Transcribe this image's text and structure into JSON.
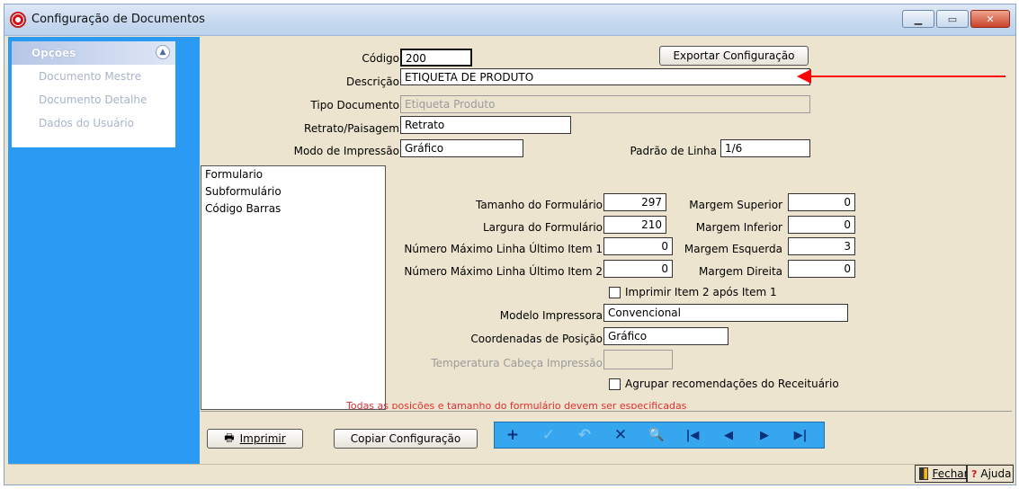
{
  "window": {
    "title": "Configuração de Documentos"
  },
  "sidebar": {
    "header": "Opções",
    "items": [
      {
        "label": "Documento Mestre"
      },
      {
        "label": "Documento Detalhe"
      },
      {
        "label": "Dados do Usuário"
      }
    ]
  },
  "form": {
    "codigo": {
      "label": "Código",
      "value": "200"
    },
    "exportar_label": "Exportar Configuração",
    "descricao": {
      "label": "Descrição",
      "value": "ETIQUETA DE PRODUTO"
    },
    "tipo_documento": {
      "label": "Tipo Documento",
      "value": "Etiqueta Produto"
    },
    "retrato": {
      "label": "Retrato/Paisagem",
      "value": "Retrato"
    },
    "modo_impressao": {
      "label": "Modo de Impressão",
      "value": "Gráfico"
    },
    "padrao_linha": {
      "label": "Padrão de Linha",
      "value": "1/6"
    }
  },
  "list": {
    "items": [
      "Formulario",
      "Subformulário",
      "Código Barras"
    ]
  },
  "details": {
    "tamanho": {
      "label": "Tamanho do Formulário",
      "value": "297"
    },
    "largura": {
      "label": "Largura do Formulário",
      "value": "210"
    },
    "num_max1": {
      "label": "Número Máximo Linha Último Item 1",
      "value": "0"
    },
    "num_max2": {
      "label": "Número Máximo Linha Último Item 2",
      "value": "0"
    },
    "margem_superior": {
      "label": "Margem Superior",
      "value": "0"
    },
    "margem_inferior": {
      "label": "Margem Inferior",
      "value": "0"
    },
    "margem_esquerda": {
      "label": "Margem Esquerda",
      "value": "3"
    },
    "margem_direita": {
      "label": "Margem Direita",
      "value": "0"
    },
    "imprimir_item2": {
      "label": "Imprimir Item 2 após Item 1",
      "checked": false
    },
    "modelo_impressora": {
      "label": "Modelo Impressora",
      "value": "Convencional"
    },
    "coordenadas": {
      "label": "Coordenadas de Posição",
      "value": "Gráfico"
    },
    "temperatura": {
      "label": "Temperatura Cabeça Impressão",
      "value": ""
    },
    "agrupar": {
      "label": "Agrupar recomendações do Receituário",
      "checked": false
    },
    "warning": "Todas as posições e tamanho do formulário devem ser especificadas"
  },
  "toolbar": {
    "imprimir_label": "Imprimir",
    "copiar_label": "Copiar Configuração",
    "nav": [
      "+",
      "✓",
      "↶",
      "✕",
      "🔍",
      "|◀",
      "◀",
      "▶",
      "▶|"
    ]
  },
  "footer": {
    "fechar_label": "Fechar",
    "ajuda_label": "Ajuda"
  },
  "colors": {
    "sidebar": "#2a9af2",
    "form_bg": "#ece4cf",
    "nav_bar": "#36a6ee",
    "annotation_arrow": "#ff0000"
  }
}
